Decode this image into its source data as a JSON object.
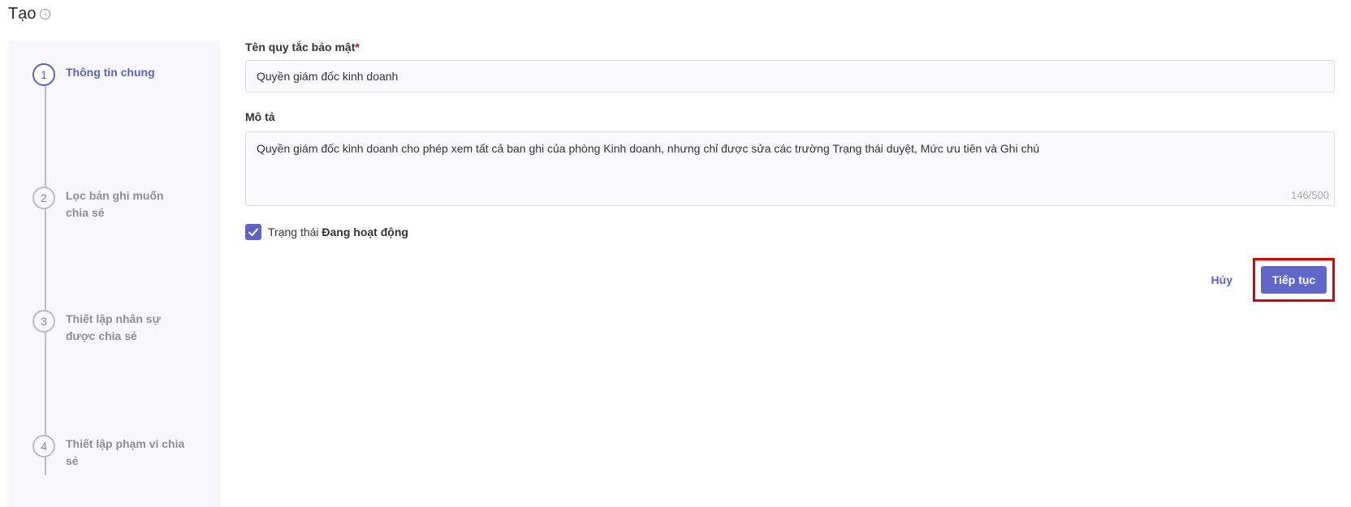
{
  "header": {
    "title": "Tạo",
    "info_icon": "info-circle-icon"
  },
  "steps": [
    {
      "number": "1",
      "label": "Thông tin chung",
      "active": true
    },
    {
      "number": "2",
      "label": "Lọc bản ghi muốn chia sẻ",
      "active": false
    },
    {
      "number": "3",
      "label": "Thiết lập nhân sự được chia sẻ",
      "active": false
    },
    {
      "number": "4",
      "label": "Thiết lập phạm vi chia sẻ",
      "active": false
    }
  ],
  "form": {
    "name_label": "Tên quy tắc bảo mật",
    "required_mark": "*",
    "name_value": "Quyền giám đốc kinh doanh",
    "description_label": "Mô tả",
    "description_value": "Quyền giám đốc kinh doanh cho phép xem tất cả ban ghi của phòng Kinh doanh, nhưng chỉ được sửa các trường Trạng thái duyệt, Mức ưu tiên và Ghi chú",
    "description_counter": "146/500",
    "status_prefix": "Trạng thái",
    "status_value": "Đang hoạt động",
    "status_checked": true
  },
  "actions": {
    "cancel_label": "Hủy",
    "next_label": "Tiếp tục"
  },
  "colors": {
    "accent": "#5c62c8",
    "highlight": "#e00000",
    "required": "#d0021b"
  }
}
